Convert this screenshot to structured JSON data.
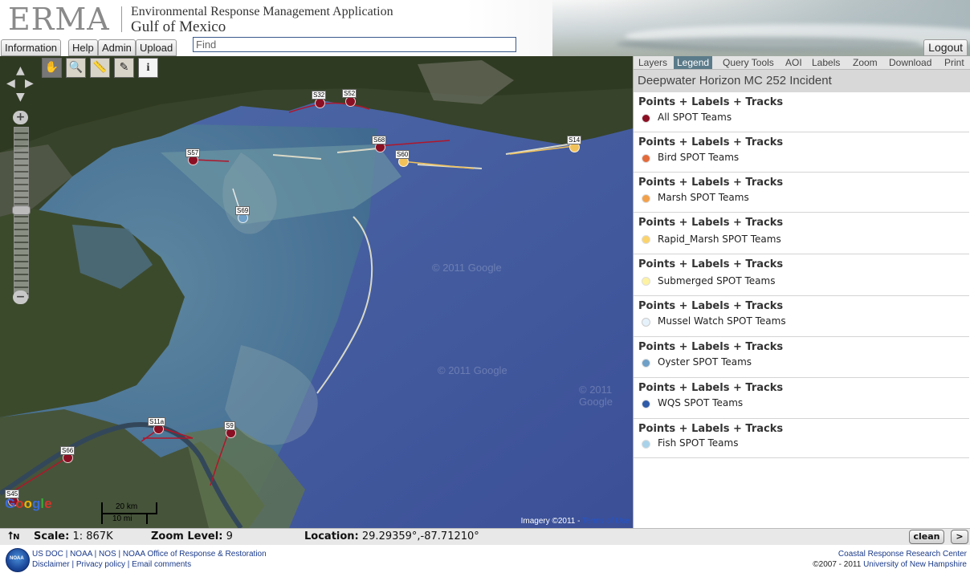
{
  "header": {
    "logo": "ERMA",
    "app_name": "Environmental Response Management Application",
    "region": "Gulf of Mexico",
    "menu": [
      "Information",
      "Help",
      "Admin",
      "Upload"
    ],
    "find_placeholder": "Find",
    "logout": "Logout"
  },
  "map": {
    "markers": [
      {
        "label": "S32",
        "color": "#8b0f23"
      },
      {
        "label": "S52",
        "color": "#8b0f23"
      },
      {
        "label": "S57",
        "color": "#8b0f23"
      },
      {
        "label": "S68",
        "color": "#8b0f23"
      },
      {
        "label": "S60",
        "color": "#f2c25a"
      },
      {
        "label": "S14",
        "color": "#f2c25a"
      },
      {
        "label": "S69",
        "color": "#6fa0c8"
      },
      {
        "label": "S11a",
        "color": "#8b0f23"
      },
      {
        "label": "S9",
        "color": "#8b0f23"
      },
      {
        "label": "S66",
        "color": "#8b0f23"
      },
      {
        "label": "S45",
        "color": "#8b0f23"
      }
    ],
    "watermark": "© 2011 Google",
    "google": "Google",
    "scale_km": "20 km",
    "scale_mi": "10 mi",
    "imagery": "Imagery ©2011 -",
    "terms": "Terms of Use"
  },
  "panel": {
    "tabs": [
      "Layers",
      "Legend",
      "Query Tools",
      "AOI",
      "Labels",
      "Zoom",
      "Download",
      "Print"
    ],
    "active_tab": "Legend",
    "incident": "Deepwater Horizon MC 252 Incident",
    "layers": [
      {
        "head": "Points + Labels + Tracks",
        "name": "All SPOT Teams",
        "color": "#8b0f23"
      },
      {
        "head": "Points + Labels + Tracks",
        "name": "Bird SPOT Teams",
        "color": "#e36a3a"
      },
      {
        "head": "Points + Labels + Tracks",
        "name": "Marsh SPOT Teams",
        "color": "#f2a14a"
      },
      {
        "head": "Points + Labels + Tracks",
        "name": "Rapid_Marsh SPOT Teams",
        "color": "#fbd36c"
      },
      {
        "head": "Points + Labels + Tracks",
        "name": "Submerged SPOT Teams",
        "color": "#fdf2a2"
      },
      {
        "head": "Points + Labels + Tracks",
        "name": "Mussel Watch SPOT Teams",
        "color": "#e6f2fb"
      },
      {
        "head": "Points + Labels + Tracks",
        "name": "Oyster SPOT Teams",
        "color": "#6fa0c8"
      },
      {
        "head": "Points + Labels + Tracks",
        "name": "WQS SPOT Teams",
        "color": "#2e5aa8"
      },
      {
        "head": "Points + Labels + Tracks",
        "name": "Fish SPOT Teams",
        "color": "#a8d2ea"
      }
    ]
  },
  "status": {
    "north": "N",
    "scale_label": "Scale:",
    "scale_value": "1: 867K",
    "zoom_label": "Zoom Level:",
    "zoom_value": "9",
    "location_label": "Location:",
    "location_value": "29.29359°,-87.71210°",
    "clean": "clean",
    "next": ">"
  },
  "footer": {
    "links_row1": [
      "US DOC",
      "NOAA",
      "NOS",
      "NOAA Office of Response & Restoration"
    ],
    "links_row2": [
      "Disclaimer",
      "Privacy policy",
      "Email comments"
    ],
    "right_row1": "Coastal Response Research Center",
    "right_row2_prefix": "©2007 - 2011",
    "right_row2_link": "University of New Hampshire"
  }
}
